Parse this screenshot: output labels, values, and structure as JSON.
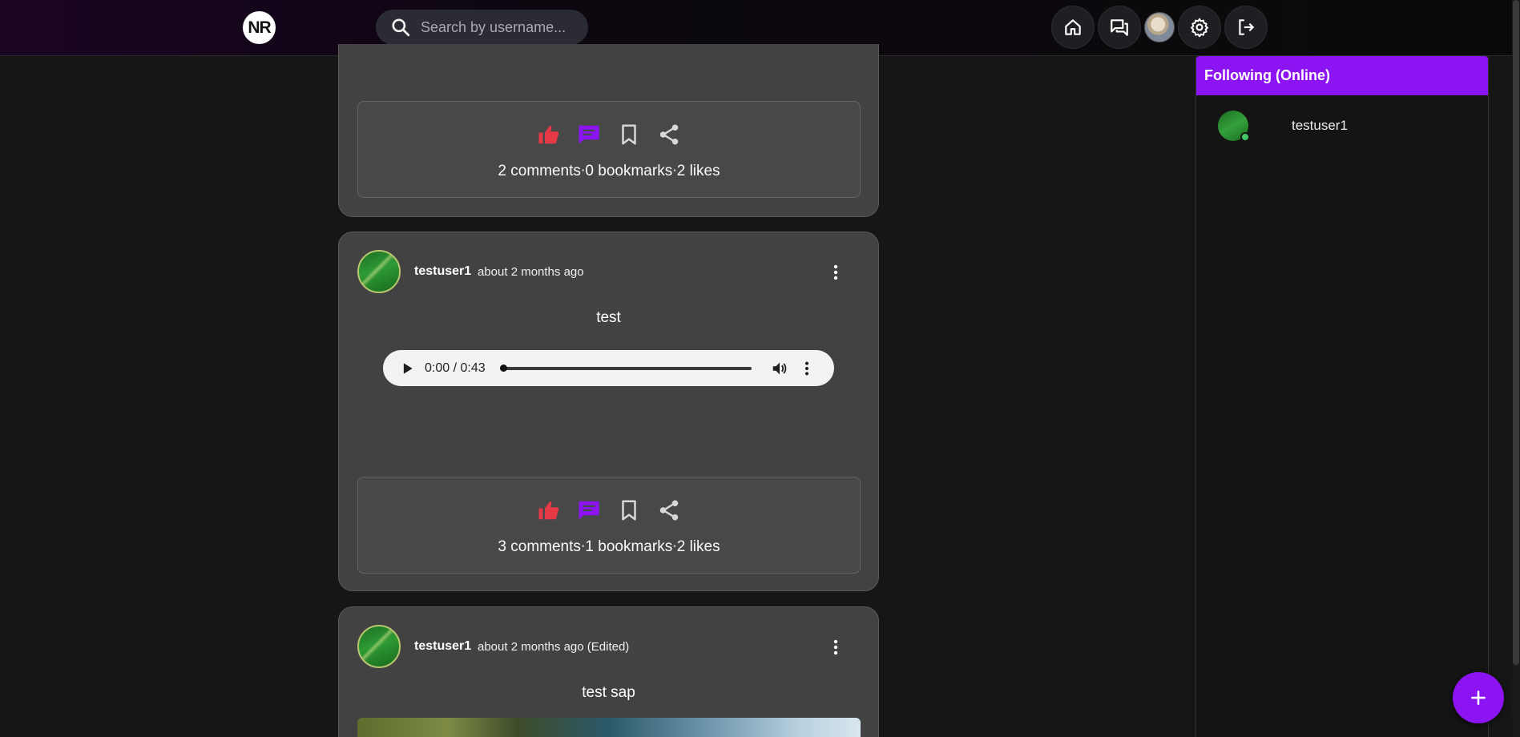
{
  "header": {
    "logo_text": "NR",
    "search_placeholder": "Search by username..."
  },
  "nav": {
    "icons": [
      "home-icon",
      "chat-icon",
      "profile-avatar",
      "settings-icon",
      "logout-icon"
    ]
  },
  "posts": [
    {
      "stats": {
        "comments": "2 comments",
        "bookmarks": "0 bookmarks",
        "likes": "2 likes"
      }
    },
    {
      "username": "testuser1",
      "time": "about 2 months ago",
      "text": "test",
      "audio_time": "0:00 / 0:43",
      "stats": {
        "comments": "3 comments",
        "bookmarks": "1 bookmarks",
        "likes": "2 likes"
      }
    },
    {
      "username": "testuser1",
      "time": "about 2 months ago (Edited)",
      "text": "test sap"
    }
  ],
  "following": {
    "title": "Following (Online)",
    "users": [
      {
        "name": "testuser1",
        "status": "online"
      }
    ]
  },
  "colors": {
    "accent": "#8c14f2",
    "like": "#e53946",
    "comment": "#8c14f2",
    "online": "#44c767"
  }
}
